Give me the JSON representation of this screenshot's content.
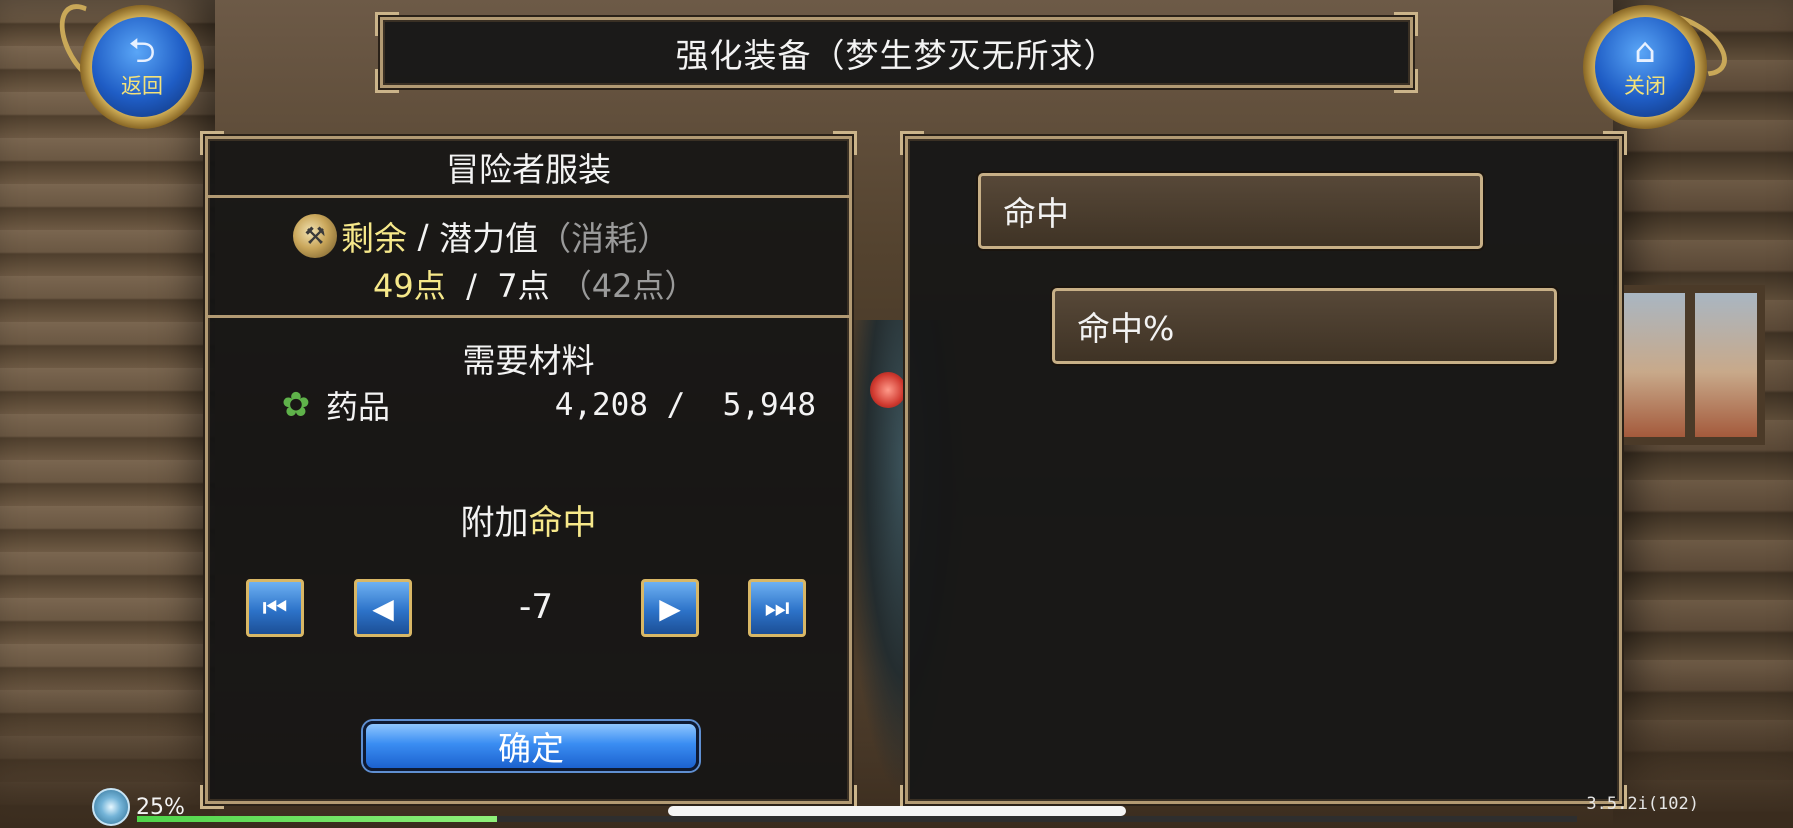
{
  "title": "强化装备（梦生梦灭无所求）",
  "nav": {
    "back": {
      "label": "返回",
      "icon": "back-arrow-icon"
    },
    "close": {
      "label": "关闭",
      "icon": "home-icon"
    }
  },
  "equipment": {
    "name": "冒险者服装",
    "points": {
      "remaining_label": "剩余",
      "separator": " / ",
      "potential_label": "潜力值",
      "consume_label": "（消耗）",
      "remaining_value": "49点",
      "potential_value": "7点",
      "consume_value": "（42点）"
    },
    "materials": {
      "title": "需要材料",
      "items": [
        {
          "name": "药品",
          "have": "4,208",
          "need": "5,948",
          "icon": "herb-icon"
        }
      ]
    },
    "attach": {
      "prefix": "附加",
      "stat": "命中"
    },
    "stepper": {
      "value": "-7"
    },
    "confirm_label": "确定"
  },
  "stats": {
    "items": [
      {
        "label": "命中"
      },
      {
        "label": "命中%"
      }
    ]
  },
  "footer": {
    "progress_label": "25%",
    "progress": 0.25,
    "version": "3.5.2i(102)"
  },
  "colors": {
    "accent_yellow": "#f6e88a",
    "frame_gold": "#b29a73",
    "button_blue": "#2d73c9"
  }
}
